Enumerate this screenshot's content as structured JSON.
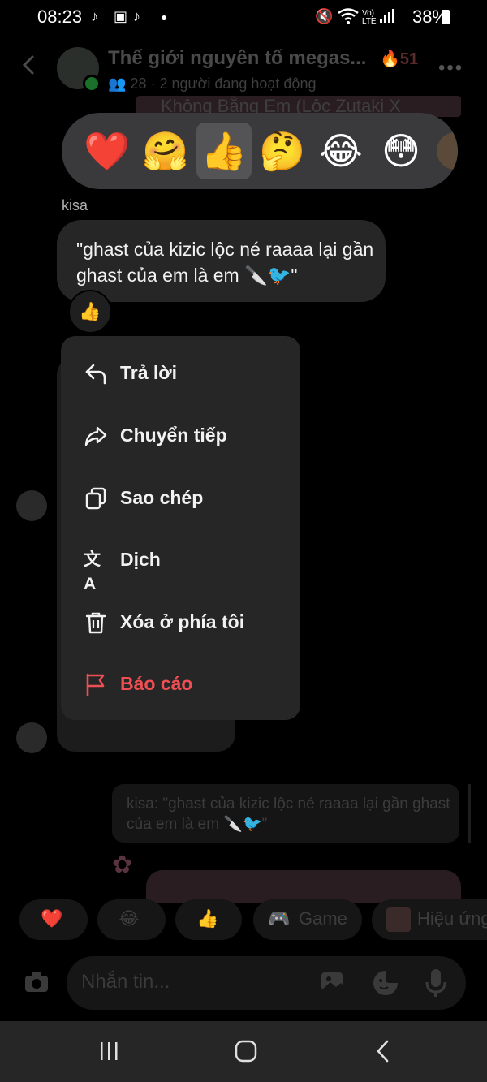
{
  "status_bar": {
    "time": "08:23",
    "battery": "38%"
  },
  "header": {
    "title": "Thế giới nguyên tố megas...",
    "streak": "51",
    "subtitle": "28 · 2 người đang hoạt động"
  },
  "reactions": {
    "emojis": [
      "❤️",
      "🤗",
      "👍",
      "🤔",
      "😂",
      "😳"
    ],
    "selected_index": 2
  },
  "message": {
    "sender": "kisa",
    "text": "\"ghast của kizic lộc né raaaa lại gần ghast của em là em 🔪🐦\"",
    "reaction": "👍"
  },
  "context_menu": {
    "items": [
      {
        "label": "Trả lời",
        "icon": "reply-icon"
      },
      {
        "label": "Chuyển tiếp",
        "icon": "forward-icon"
      },
      {
        "label": "Sao chép",
        "icon": "copy-icon"
      },
      {
        "label": "Dịch",
        "icon": "translate-icon"
      },
      {
        "label": "Xóa ở phía tôi",
        "icon": "trash-icon"
      },
      {
        "label": "Báo cáo",
        "icon": "flag-icon"
      }
    ]
  },
  "background": {
    "banner_text": "Không Bằng Em (Lộc Zutaki X",
    "quoted_reply": "kisa: \"ghast của kizic lộc né raaaa lại gần ghast của em là em 🔪🐦\""
  },
  "quick_reactions": {
    "heart": "❤️",
    "laugh": "😂",
    "thumbs": "👍",
    "game": "Game",
    "effects": "Hiệu ứng"
  },
  "composer": {
    "placeholder": "Nhắn tin..."
  },
  "colors": {
    "danger": "#ef4e52",
    "menu_bg": "#262626",
    "reaction_bar_bg": "#3a3a3c"
  }
}
